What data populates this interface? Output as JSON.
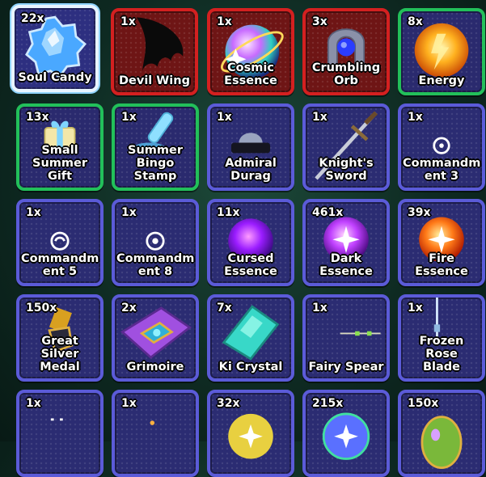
{
  "inventory": {
    "items": [
      {
        "count": "22x",
        "name": "Soul Candy",
        "icon": "soul-candy-icon"
      },
      {
        "count": "1x",
        "name": "Devil Wing",
        "icon": "devil-wing-icon"
      },
      {
        "count": "1x",
        "name": "Cosmic\nEssence",
        "icon": "cosmic-essence-icon"
      },
      {
        "count": "3x",
        "name": "Crumbling\nOrb",
        "icon": "crumbling-orb-icon"
      },
      {
        "count": "8x",
        "name": "Energy",
        "icon": "energy-icon"
      },
      {
        "count": "13x",
        "name": "Small\nSummer\nGift",
        "icon": "summer-gift-icon"
      },
      {
        "count": "1x",
        "name": "Summer\nBingo\nStamp",
        "icon": "bingo-stamp-icon"
      },
      {
        "count": "1x",
        "name": "Admiral\nDurag",
        "icon": "admiral-durag-icon"
      },
      {
        "count": "1x",
        "name": "Knight's\nSword",
        "icon": "knight-sword-icon"
      },
      {
        "count": "1x",
        "name": "Commandm\nent 3",
        "icon": "commandment-icon"
      },
      {
        "count": "1x",
        "name": "Commandm\nent 5",
        "icon": "commandment-icon"
      },
      {
        "count": "1x",
        "name": "Commandm\nent 8",
        "icon": "commandment-icon"
      },
      {
        "count": "11x",
        "name": "Cursed\nEssence",
        "icon": "cursed-essence-icon"
      },
      {
        "count": "461x",
        "name": "Dark\nEssence",
        "icon": "dark-essence-icon"
      },
      {
        "count": "39x",
        "name": "Fire\nEssence",
        "icon": "fire-essence-icon"
      },
      {
        "count": "150x",
        "name": "Great Silver\nMedal",
        "icon": "silver-medal-icon"
      },
      {
        "count": "2x",
        "name": "Grimoire",
        "icon": "grimoire-icon"
      },
      {
        "count": "7x",
        "name": "Ki Crystal",
        "icon": "ki-crystal-icon"
      },
      {
        "count": "1x",
        "name": "Fairy Spear",
        "icon": "fairy-spear-icon"
      },
      {
        "count": "1x",
        "name": "Frozen Rose\nBlade",
        "icon": "frozen-rose-blade-icon"
      },
      {
        "count": "1x",
        "name": "",
        "icon": "unknown-item-icon"
      },
      {
        "count": "1x",
        "name": "",
        "icon": "unknown-item-icon"
      },
      {
        "count": "32x",
        "name": "",
        "icon": "essence-orb-icon"
      },
      {
        "count": "215x",
        "name": "",
        "icon": "essence-orb-icon"
      },
      {
        "count": "150x",
        "name": "",
        "icon": "egg-icon"
      }
    ]
  }
}
